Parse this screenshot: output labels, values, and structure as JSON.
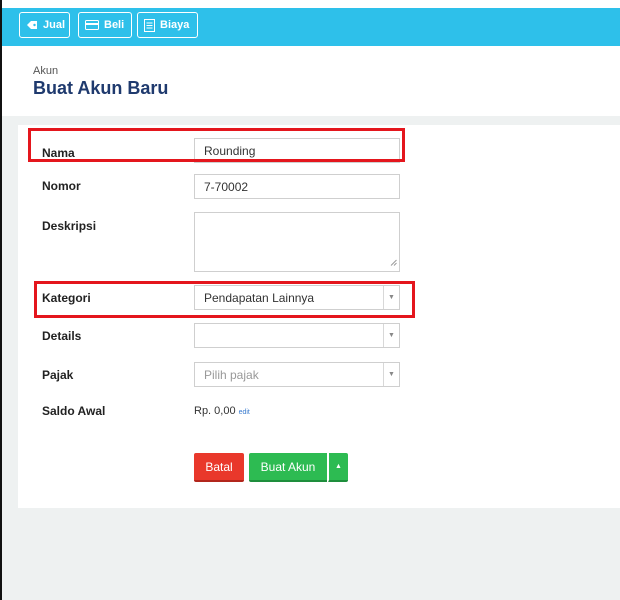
{
  "toolbar": {
    "jual_label": "Jual",
    "beli_label": "Beli",
    "biaya_label": "Biaya"
  },
  "header": {
    "breadcrumb": "Akun",
    "title": "Buat Akun Baru"
  },
  "form": {
    "nama": {
      "label": "Nama",
      "value": "Rounding"
    },
    "nomor": {
      "label": "Nomor",
      "value": "7-70002"
    },
    "deskripsi": {
      "label": "Deskripsi",
      "value": ""
    },
    "kategori": {
      "label": "Kategori",
      "value": "Pendapatan Lainnya"
    },
    "details": {
      "label": "Details",
      "value": ""
    },
    "pajak": {
      "label": "Pajak",
      "placeholder": "Pilih pajak"
    },
    "saldo_awal": {
      "label": "Saldo Awal",
      "value": "Rp. 0,00",
      "edit_link": "edit"
    }
  },
  "actions": {
    "cancel_label": "Batal",
    "create_label": "Buat Akun"
  },
  "colors": {
    "toolbar_bg": "#2ec0ea",
    "title": "#1f3a6e",
    "cancel": "#e9382b",
    "create": "#2dbb52",
    "highlight": "#e4161d"
  }
}
